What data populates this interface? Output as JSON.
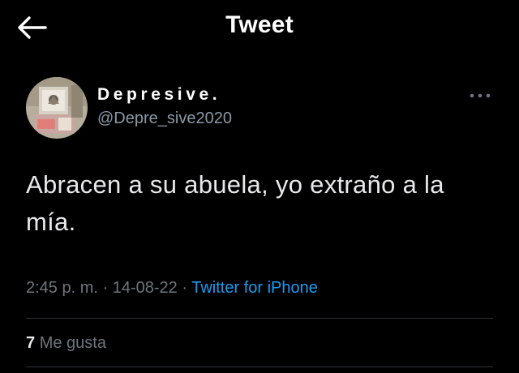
{
  "header": {
    "title": "Tweet",
    "back_icon": "arrow-left-icon"
  },
  "author": {
    "display_name": "Depresive.",
    "handle": "@Depre_sive2020",
    "avatar_icon": "avatar-image",
    "more_icon": "more-horizontal-icon"
  },
  "tweet": {
    "text": "Abracen a su abuela, yo extraño a la mía."
  },
  "meta": {
    "time": "2:45 p. m.",
    "separator1": "·",
    "date": "14-08-22",
    "separator2": "·",
    "source": "Twitter for iPhone"
  },
  "stats": {
    "likes_count": "7",
    "likes_label": "Me gusta"
  },
  "colors": {
    "background": "#000000",
    "text_primary": "#e7e9ea",
    "text_secondary": "#6e767d",
    "accent": "#1d9bf0",
    "divider": "#2f3336"
  }
}
